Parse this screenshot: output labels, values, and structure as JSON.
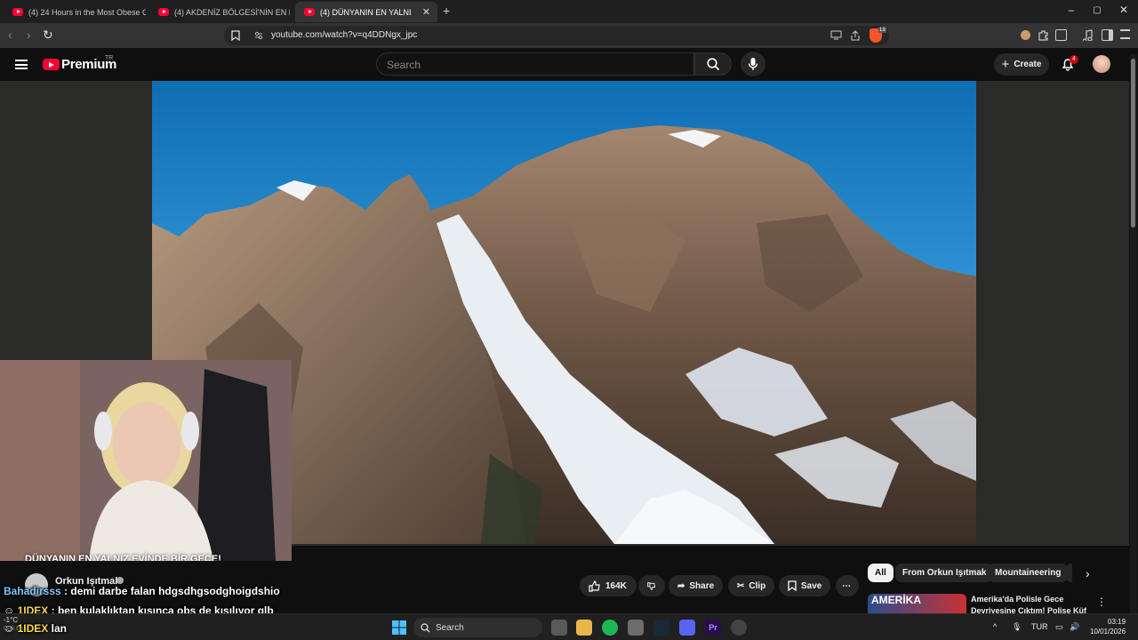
{
  "browser": {
    "tabs": [
      {
        "label": "(4) 24 Hours in the Most Obese City i"
      },
      {
        "label": "(4) AKDENİZ BÖLGESİ'NİN EN DÜŞÜK"
      },
      {
        "label": "(4) DÜNYANIN EN YALNIZ EVİNE",
        "active": true
      }
    ],
    "new_tab": "+",
    "url": "youtube.com/watch?v=q4DDNgx_jpc",
    "shield_badge": "13",
    "window_controls": [
      "–",
      "▢",
      "✕"
    ]
  },
  "youtube": {
    "logo_text": "Premium",
    "region": "TR",
    "search_placeholder": "Search",
    "create_label": "Create",
    "notification_count": "4"
  },
  "video": {
    "title_overlay": "DÜNYANIN EN YALNIZ EVİNDE BİR GECE!",
    "channel": "Orkun Işıtmak",
    "likes": "164K",
    "share_label": "Share",
    "clip_label": "Clip",
    "save_label": "Save",
    "more_label": "⋯"
  },
  "chips": [
    "All",
    "From Orkun Işıtmak",
    "Mountaineering"
  ],
  "recommendation": {
    "thumb_text": "AMERİKA",
    "title_line1": "Amerika'da Polisle Gece",
    "title_line2": "Devriyesine Çıktım! Polise Küf"
  },
  "chat": [
    {
      "user": "Bahadirsss",
      "sep": " : ",
      "msg": "demi darbe falan hdgsdhgsodghoigdshio"
    },
    {
      "user": "1IDEX",
      "sep": " : ",
      "msg": "ben kulaklıktan kısınca obs de kısılıyor glb"
    },
    {
      "user": "1IDEX",
      "sep": " ",
      "msg": "lan"
    }
  ],
  "taskbar": {
    "search_label": "Search",
    "weather": "-1°C",
    "weather_sub": "Çok bulutlu",
    "language": "TUR",
    "time": "03:19",
    "date": "10/01/2026"
  },
  "colors": {
    "youtube_red": "#ff0033",
    "background": "#0f0f0f",
    "sky": "#2b8fd0"
  }
}
